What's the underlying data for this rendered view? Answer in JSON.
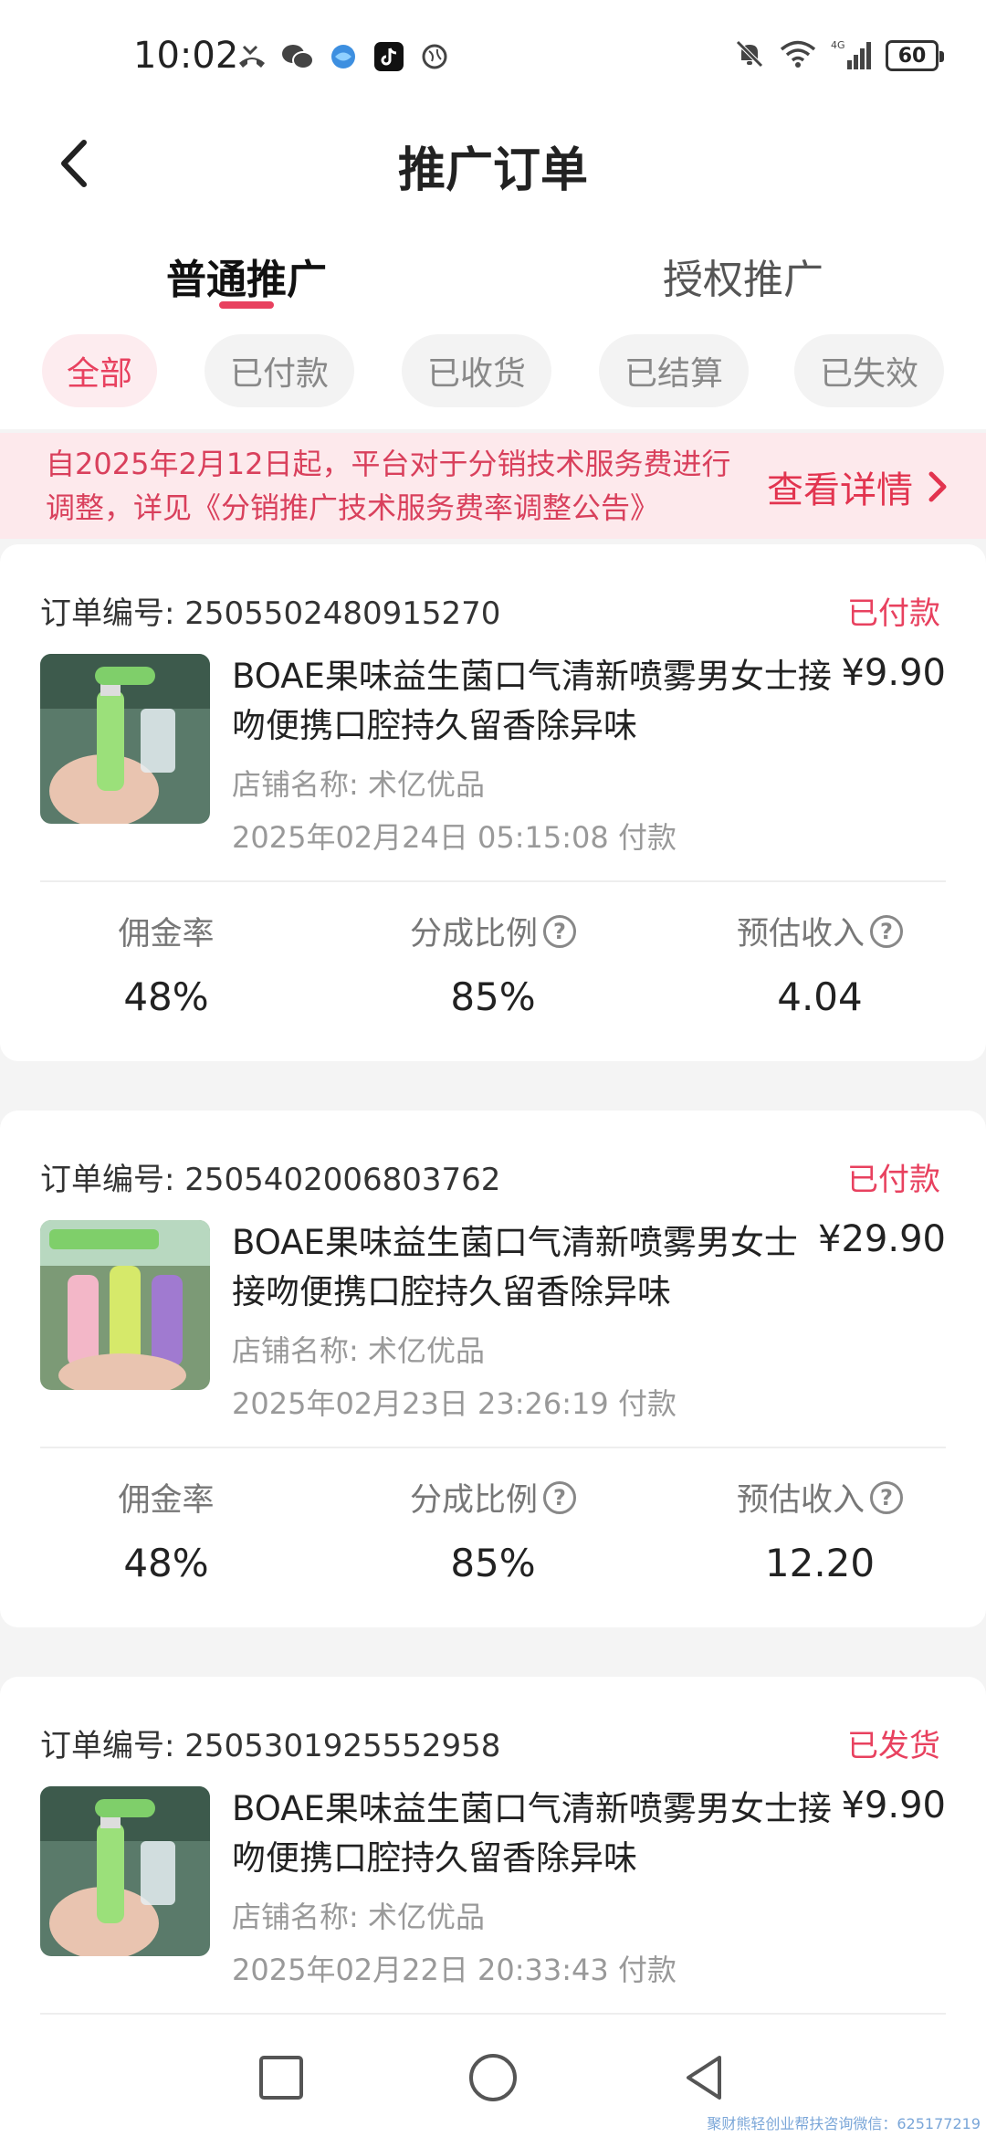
{
  "status_bar": {
    "time": "10:02",
    "battery": "60",
    "network": "4G"
  },
  "header": {
    "title": "推广订单"
  },
  "tabs": [
    {
      "label": "普通推广"
    },
    {
      "label": "授权推广"
    }
  ],
  "filters": [
    {
      "label": "全部"
    },
    {
      "label": "已付款"
    },
    {
      "label": "已收货"
    },
    {
      "label": "已结算"
    },
    {
      "label": "已失效"
    }
  ],
  "notice": {
    "line1": "自2025年2月12日起，平台对于分销技术服务费进行",
    "line2": "调整，详见《分销推广技术服务费率调整公告》",
    "link": "查看详情"
  },
  "orders": [
    {
      "order_label": "订单编号:",
      "order_no": "2505502480915270",
      "status": "已付款",
      "name_line1": "BOAE果味益生菌口气清新喷雾男女士接",
      "name_line2": "吻便携口腔持久留香除异味",
      "price": "¥9.90",
      "shop": "店铺名称: 术亿优品",
      "pay_time": "2025年02月24日 05:15:08 付款",
      "stats": [
        {
          "label": "佣金率",
          "value": "48%"
        },
        {
          "label": "分成比例",
          "value": "85%"
        },
        {
          "label": "预估收入",
          "value": "4.04"
        }
      ]
    },
    {
      "order_label": "订单编号:",
      "order_no": "2505402006803762",
      "status": "已付款",
      "name_line1": "BOAE果味益生菌口气清新喷雾男女士",
      "name_line2": "接吻便携口腔持久留香除异味",
      "price": "¥29.90",
      "shop": "店铺名称: 术亿优品",
      "pay_time": "2025年02月23日 23:26:19 付款",
      "stats": [
        {
          "label": "佣金率",
          "value": "48%"
        },
        {
          "label": "分成比例",
          "value": "85%"
        },
        {
          "label": "预估收入",
          "value": "12.20"
        }
      ]
    },
    {
      "order_label": "订单编号:",
      "order_no": "2505301925552958",
      "status": "已发货",
      "name_line1": "BOAE果味益生菌口气清新喷雾男女士接",
      "name_line2": "吻便携口腔持久留香除异味",
      "price": "¥9.90",
      "shop": "店铺名称: 术亿优品",
      "pay_time": "2025年02月22日 20:33:43 付款"
    }
  ],
  "watermark": "聚财熊轻创业帮扶咨询微信：625177219",
  "colors": {
    "accent": "#e8415f",
    "notice_bg": "#fde9ec"
  }
}
